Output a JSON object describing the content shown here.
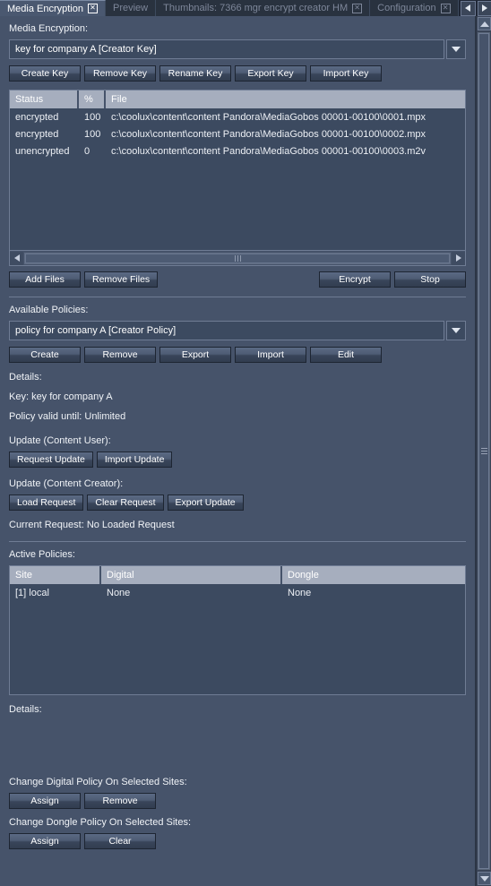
{
  "tabs": [
    {
      "label": "Media Encryption",
      "active": true,
      "closable": true
    },
    {
      "label": "Preview",
      "active": false,
      "closable": false
    },
    {
      "label": "Thumbnails: 7366 mgr encrypt creator HM",
      "active": false,
      "closable": true
    },
    {
      "label": "Configuration",
      "active": false,
      "closable": true
    }
  ],
  "tab_nav": {
    "prev": "◀",
    "next": "▶"
  },
  "media_encryption": {
    "section_label": "Media Encryption:",
    "key_combo_value": "key for company A [Creator Key]",
    "key_buttons": [
      "Create Key",
      "Remove Key",
      "Rename Key",
      "Export Key",
      "Import Key"
    ],
    "file_table": {
      "columns": [
        "Status",
        "%",
        "File"
      ],
      "rows": [
        [
          "encrypted",
          "100",
          "c:\\coolux\\content\\content Pandora\\MediaGobos 00001-00100\\0001.mpx"
        ],
        [
          "encrypted",
          "100",
          "c:\\coolux\\content\\content Pandora\\MediaGobos 00001-00100\\0002.mpx"
        ],
        [
          "unencrypted",
          "0",
          "c:\\coolux\\content\\content Pandora\\MediaGobos 00001-00100\\0003.m2v"
        ]
      ]
    },
    "file_buttons_left": [
      "Add Files",
      "Remove Files"
    ],
    "file_buttons_right": [
      "Encrypt",
      "Stop"
    ]
  },
  "available_policies": {
    "section_label": "Available Policies:",
    "combo_value": "policy for company A [Creator Policy]",
    "buttons": [
      "Create",
      "Remove",
      "Export",
      "Import",
      "Edit"
    ],
    "details_label": "Details:",
    "detail_key": "Key: key for company A",
    "detail_validity": "Policy valid until: Unlimited"
  },
  "update_content_user": {
    "label": "Update (Content User):",
    "buttons": [
      "Request Update",
      "Import Update"
    ]
  },
  "update_content_creator": {
    "label": "Update (Content Creator):",
    "buttons": [
      "Load Request",
      "Clear Request",
      "Export Update"
    ],
    "current_request": "Current Request: No Loaded Request"
  },
  "active_policies": {
    "section_label": "Active Policies:",
    "columns": [
      "Site",
      "Digital",
      "Dongle"
    ],
    "rows": [
      [
        "[1] local",
        "None",
        "None"
      ]
    ],
    "details_label": "Details:"
  },
  "change_digital": {
    "label": "Change Digital Policy On Selected Sites:",
    "buttons": [
      "Assign",
      "Remove"
    ]
  },
  "change_dongle": {
    "label": "Change Dongle Policy On Selected Sites:",
    "buttons": [
      "Assign",
      "Clear"
    ]
  },
  "colors": {
    "background": "#46536a",
    "tabbar": "#1f2736",
    "header_row": "#a6aebe",
    "field": "#3c4a60",
    "border": "#6f7c94",
    "text": "#f0f3f7"
  }
}
